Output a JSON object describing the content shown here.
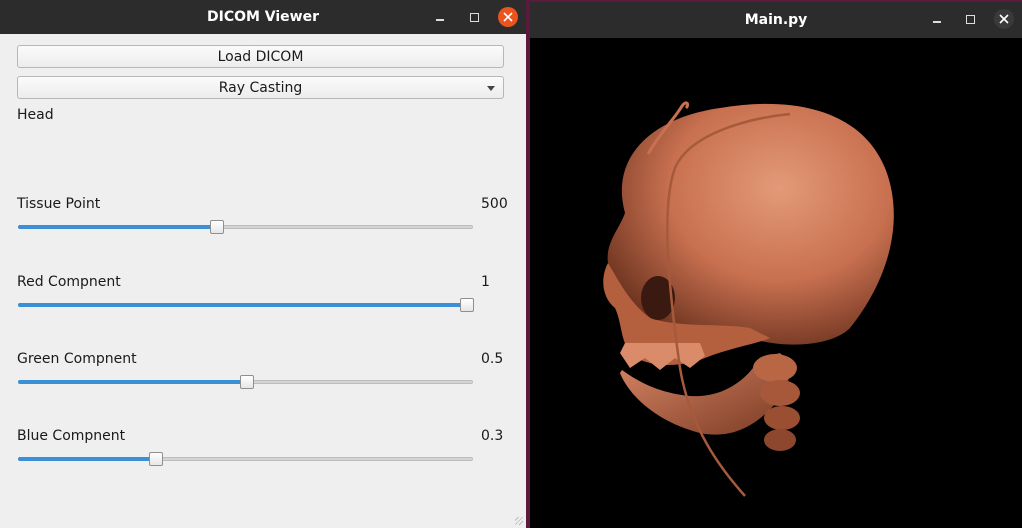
{
  "left_window": {
    "title": "DICOM Viewer",
    "load_button_label": "Load DICOM",
    "render_mode": "Ray Casting",
    "preset_label": "Head",
    "sliders": [
      {
        "label": "Tissue Point",
        "value_text": "500",
        "fraction": 0.435
      },
      {
        "label": "Red Compnent",
        "value_text": "1",
        "fraction": 1.0
      },
      {
        "label": "Green Compnent",
        "value_text": "0.5",
        "fraction": 0.5
      },
      {
        "label": "Blue Compnent",
        "value_text": "0.3",
        "fraction": 0.3
      }
    ]
  },
  "right_window": {
    "title": "Main.py",
    "render_color": "#c87050"
  },
  "colors": {
    "accent": "#3b8fd6",
    "close_active": "#e9541f",
    "titlebar": "#2c2c2c",
    "panel": "#efefef"
  },
  "icons": {
    "minimize": "minimize-icon",
    "maximize": "maximize-icon",
    "close": "close-icon"
  }
}
